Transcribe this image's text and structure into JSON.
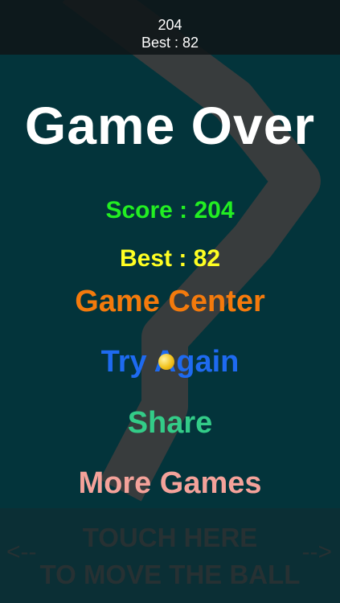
{
  "hud": {
    "score": "204",
    "best": "Best : 82"
  },
  "game_over": {
    "title": "Game Over",
    "score_label": "Score : 204",
    "best_label": "Best : 82"
  },
  "menu": {
    "game_center": "Game Center",
    "try_again": "Try Again",
    "share": "Share",
    "more_games": "More Games"
  },
  "controls": {
    "line1": "TOUCH HERE",
    "line2": "TO MOVE THE BALL",
    "left_arrow": "<--",
    "right_arrow": "-->"
  },
  "colors": {
    "background": "#03343b",
    "title": "#ffffff",
    "score": "#22ee22",
    "best": "#ffff22",
    "game_center": "#f47a0c",
    "try_again": "#1e6af0",
    "share": "#33cc88",
    "more_games": "#f4a29a",
    "touch_text": "#273133",
    "track": "#3b3d3d"
  },
  "icons": {
    "ball": "ball-icon",
    "left": "left-arrow-icon",
    "right": "right-arrow-icon"
  }
}
